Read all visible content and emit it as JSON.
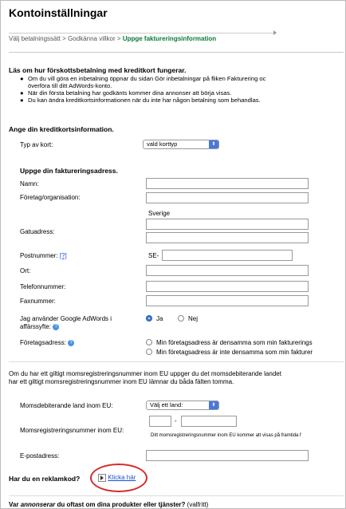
{
  "title": "Kontoinställningar",
  "breadcrumbs": {
    "step1": "Välj betalningssätt",
    "sep1": ">",
    "step2": "Godkänna villkor",
    "sep2": ">",
    "step3": "Uppge faktureringsinformation"
  },
  "info": {
    "heading": "Läs om hur förskottsbetalning med kreditkort fungerar.",
    "bullets": [
      "Om du vill göra en inbetalning öppnar du sidan Gör inbetalningar på fliken Fakturering oc",
      "överföra till ditt AdWords-konto.",
      "När din första betalning har godkänts kommer dina annonser att börja visas.",
      "Du kan ändra kreditkortsinformationen när du inte har någon betalning som behandlas."
    ]
  },
  "card": {
    "heading": "Ange din kreditkortsinformation.",
    "type_label": "Typ av kort:",
    "type_value": "vald korttyp"
  },
  "address": {
    "heading": "Uppge din faktureringsadress.",
    "name_label": "Namn:",
    "company_label": "Företag/organisation:",
    "country_value": "Sverige",
    "street_label": "Gatuadress:",
    "postal_label": "Postnummer:",
    "postal_help": "[?]",
    "postal_prefix": "SE-",
    "city_label": "Ort:",
    "phone_label": "Telefonnummer:",
    "fax_label": "Faxnummer:"
  },
  "usage": {
    "label_line1": "Jag använder Google AdWords i",
    "label_line2": "affärssyfte:",
    "yes": "Ja",
    "no": "Nej",
    "selected": "Ja"
  },
  "company_address": {
    "label": "Företagsadress:",
    "option1": "Min företagsadress är densamma som min fakturerings",
    "option2": "Min företagsadress är inte densamma som min fakturer"
  },
  "vat": {
    "info_line1": "Om du har ett giltigt momsregistreringsnummer inom EU uppger du det momsdebiterande landet",
    "info_line2": "har ett giltigt momsregistreringsnummer inom EU lämnar du båda fälten tomma.",
    "country_label": "Momsdebiterande land inom EU:",
    "country_value": "Välj ett land:",
    "number_label": "Momsregistreringsnummer inom EU:",
    "number_sep": "-",
    "number_note": "Ditt momsregistreringsnummer inom EU kommer att visas på framtida f"
  },
  "email": {
    "label": "E-postadress:"
  },
  "promo": {
    "question": "Har du en reklamkod?",
    "link": "Klicka här"
  },
  "advertise": {
    "question_start": "Var",
    "question_em": "annonserar",
    "question_end": "du oftast om dina produkter eller tjänster?",
    "optional": "(valfritt)"
  },
  "colors": {
    "accent_green": "#0a7a3a",
    "link_blue": "#1a4fd0",
    "radio_blue": "#3a7ad9",
    "highlight_red": "#d42a2a"
  },
  "icons": {
    "help": "question-circle-icon",
    "select_arrow": "up-down-arrows-icon",
    "link_arrow": "play-arrow-icon"
  }
}
